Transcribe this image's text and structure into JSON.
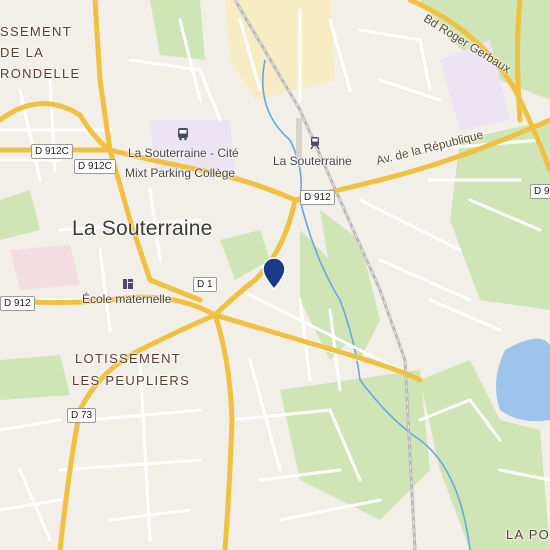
{
  "map": {
    "city_label": "La Souterraine",
    "districts": {
      "top_left_line1": "SSEMENT",
      "top_left_line2": "DE LA",
      "top_left_line3": "RONDELLE",
      "peupliers_line1": "LOTISSEMENT",
      "peupliers_line2": "LES PEUPLIERS",
      "bottom_right": "LA PO"
    },
    "pois": {
      "bus_stop_line1": "La Souterraine - Cité",
      "bus_stop_line2": "Mixt Parking Collège",
      "train_station": "La Souterraine",
      "school": "École maternelle"
    },
    "roads": {
      "d912c_left": "D 912C",
      "d912c_right": "D 912C",
      "d912_center": "D 912",
      "d912_left": "D 912",
      "d912_right": "D 91",
      "d1": "D 1",
      "d73": "D 73",
      "av_republique": "Av. de la République",
      "bd_gerbaux": "Bd Roger Gerbaux"
    },
    "colors": {
      "background": "#f2efe9",
      "road_major": "#f6c64a",
      "road_minor": "#ffffff",
      "park": "#cfe5b5",
      "water": "#9ec4ec",
      "river": "#6aa6e0",
      "marker": "#1b3a8a"
    }
  }
}
